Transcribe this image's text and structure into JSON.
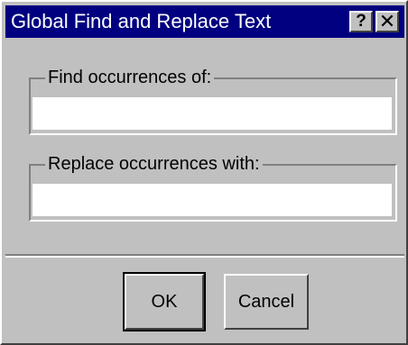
{
  "window": {
    "title": "Global Find and Replace Text",
    "help_glyph": "?",
    "close_glyph": "✕"
  },
  "find": {
    "label": "Find occurrences of:",
    "value": "",
    "placeholder": ""
  },
  "replace": {
    "label": "Replace occurrences with:",
    "value": "",
    "placeholder": ""
  },
  "buttons": {
    "ok_label": "OK",
    "cancel_label": "Cancel"
  },
  "colors": {
    "titlebar": "#000080",
    "face": "#c0c0c0",
    "field": "#ffffff"
  },
  "icons": {
    "help": "help-icon",
    "close": "close-icon"
  }
}
